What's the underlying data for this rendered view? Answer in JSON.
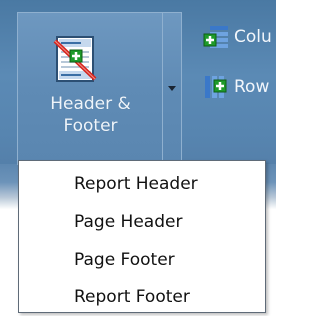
{
  "ribbon": {
    "header_footer_button": {
      "label_line1": "Header &",
      "label_line2": "Footer",
      "icon": "header-footer-icon"
    },
    "dropdown_arrow_icon": "chevron-down-icon",
    "small_buttons": [
      {
        "label": "Colu",
        "icon": "insert-column-icon"
      },
      {
        "label": "Row",
        "icon": "insert-row-icon"
      }
    ]
  },
  "menu": {
    "items": [
      {
        "label": "Report Header"
      },
      {
        "label": "Page Header"
      },
      {
        "label": "Page Footer"
      },
      {
        "label": "Report Footer"
      }
    ]
  },
  "colors": {
    "ribbon_blue": "#5b8ab5",
    "menu_border": "#5f6b78",
    "icon_green": "#1e9a2a"
  }
}
